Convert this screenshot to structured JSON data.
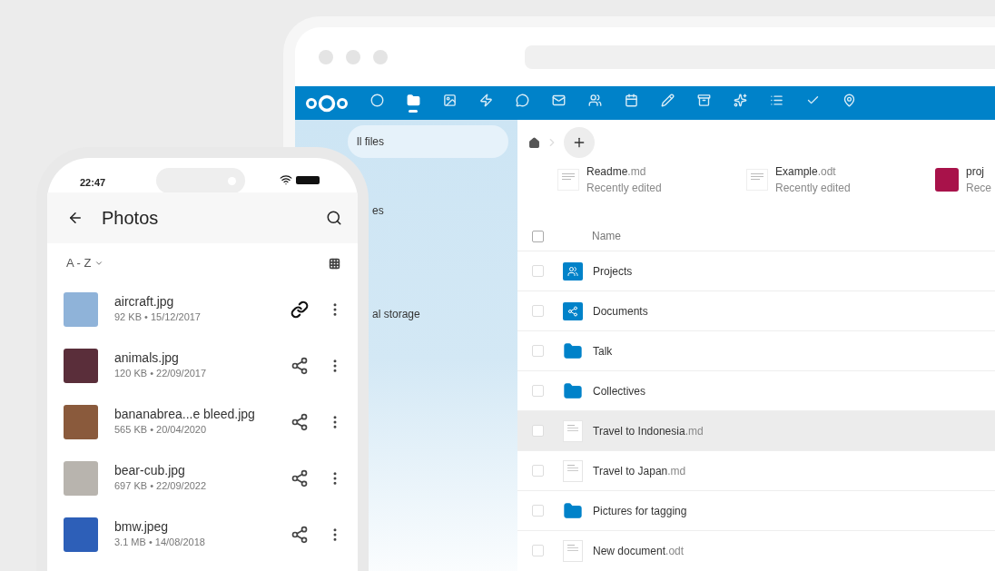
{
  "browser": {
    "apps": [
      {
        "selected": false
      },
      {
        "selected": true
      },
      {
        "selected": false
      },
      {
        "selected": false
      },
      {
        "selected": false
      },
      {
        "selected": false
      },
      {
        "selected": false
      },
      {
        "selected": false
      },
      {
        "selected": false
      },
      {
        "selected": false
      },
      {
        "selected": false
      },
      {
        "selected": false
      },
      {
        "selected": false
      },
      {
        "selected": false
      }
    ],
    "sidebar": {
      "items": [
        {
          "label": "ll files",
          "selected": true
        },
        {
          "label": "es",
          "selected": false
        },
        {
          "label": "al storage",
          "selected": false
        }
      ]
    },
    "recent": [
      {
        "name": "Readme",
        "ext": ".md",
        "note": "Recently edited",
        "kind": "text"
      },
      {
        "name": "Example",
        "ext": ".odt",
        "note": "Recently edited",
        "kind": "text"
      },
      {
        "name": "proj",
        "note": "Rece",
        "kind": "image"
      }
    ],
    "table": {
      "columns": [
        "Name"
      ],
      "select_all": {
        "checked": false
      },
      "rows": [
        {
          "name": "Projects",
          "kind": "group-folder",
          "hovered": false,
          "checked": false
        },
        {
          "name": "Documents",
          "kind": "shared-folder",
          "hovered": false,
          "checked": false
        },
        {
          "name": "Talk",
          "kind": "folder",
          "hovered": false,
          "checked": false
        },
        {
          "name": "Collectives",
          "kind": "folder",
          "hovered": false,
          "checked": false
        },
        {
          "name": "Travel to Indonesia",
          "ext": ".md",
          "kind": "file",
          "hovered": true,
          "checked": false
        },
        {
          "name": "Travel to Japan",
          "ext": ".md",
          "kind": "file",
          "hovered": false,
          "checked": false
        },
        {
          "name": "Pictures for tagging",
          "kind": "folder",
          "hovered": false,
          "checked": false
        },
        {
          "name": "New document",
          "ext": ".odt",
          "kind": "file",
          "hovered": false,
          "checked": false
        }
      ]
    }
  },
  "phone": {
    "time": "22:47",
    "title": "Photos",
    "sort": "A - Z",
    "files": [
      {
        "name": "aircraft.jpg",
        "meta": "92 KB • 15/12/2017",
        "kind": "link"
      },
      {
        "name": "animals.jpg",
        "meta": "120 KB • 22/09/2017",
        "kind": "share"
      },
      {
        "name": "bananabrea...e bleed.jpg",
        "meta": "565 KB • 20/04/2020",
        "kind": "share"
      },
      {
        "name": "bear-cub.jpg",
        "meta": "697 KB • 22/09/2022",
        "kind": "share"
      },
      {
        "name": "bmw.jpeg",
        "meta": "3.1 MB • 14/08/2018",
        "kind": "share"
      }
    ]
  }
}
